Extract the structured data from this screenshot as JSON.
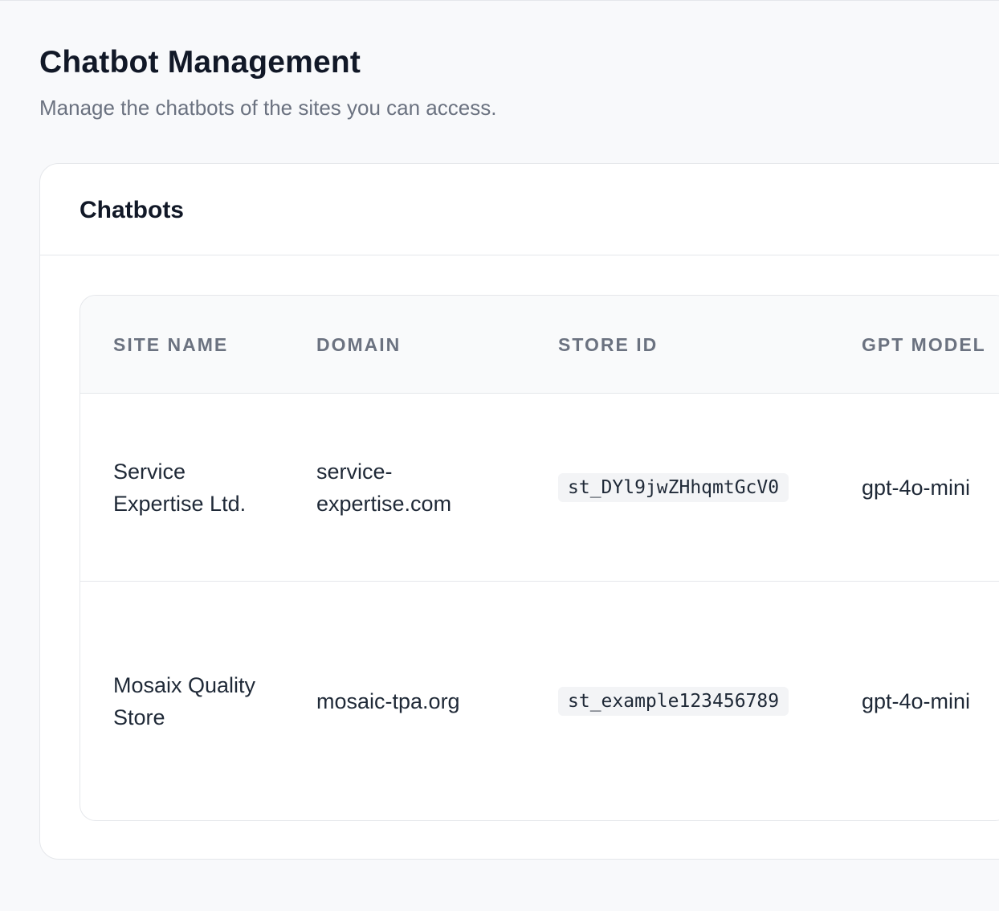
{
  "header": {
    "title": "Chatbot Management",
    "subtitle": "Manage the chatbots of the sites you can access."
  },
  "card": {
    "title": "Chatbots"
  },
  "table": {
    "columns": [
      "SITE NAME",
      "DOMAIN",
      "STORE ID",
      "GPT MODEL"
    ],
    "rows": [
      {
        "site_name": "Service Expertise Ltd.",
        "domain": "service-expertise.com",
        "store_id": "st_DYl9jwZHhqmtGcV0",
        "gpt_model": "gpt-4o-mini"
      },
      {
        "site_name": "Mosaix Quality Store",
        "domain": "mosaic-tpa.org",
        "store_id": "st_example123456789",
        "gpt_model": "gpt-4o-mini"
      }
    ]
  },
  "colors": {
    "page_background": "#f8f9fb",
    "card_background": "#ffffff",
    "border": "#e5e7eb",
    "heading_text": "#111827",
    "muted_text": "#6b7280",
    "code_background": "#f3f4f6"
  }
}
